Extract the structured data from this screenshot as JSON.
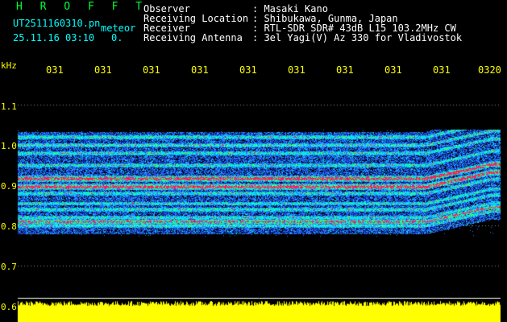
{
  "header": {
    "app_name": "H R O F F T",
    "file_name": "UT2511160310.pn",
    "event_type": "meteor",
    "datetime": "25.11.16 03:10",
    "count": "0.",
    "fields": [
      {
        "label": "Observer",
        "value": ": Masaki Kano"
      },
      {
        "label": "Receiving Location",
        "value": ": Shibukawa, Gunma, Japan"
      },
      {
        "label": "Receiver",
        "value": ": RTL-SDR SDR# 43dB L15 103.2MHz CW"
      },
      {
        "label": "Receiving Antenna",
        "value": ": 3el Yagi(V) Az 330 for Vladivostok"
      }
    ]
  },
  "chart_data": {
    "type": "heatmap",
    "ylabel": "kHz",
    "yticks": [
      "1.1",
      "1.0",
      "0.9",
      "0.8",
      "0.7",
      "0.6"
    ],
    "xticks": [
      "031",
      "031",
      "031",
      "031",
      "031",
      "031",
      "031",
      "031",
      "031",
      "0320"
    ],
    "ylim": [
      0.6,
      1.1
    ],
    "bands_khz": [
      0.8,
      0.82,
      0.84,
      0.855,
      0.88,
      0.9,
      0.92,
      0.95,
      0.98,
      1.0,
      1.02
    ],
    "strong_bands_khz": [
      0.81,
      0.895,
      0.915
    ],
    "signal_extent_khz": [
      0.785,
      1.03
    ],
    "colors": {
      "background": "#000000",
      "noise_low": "#0a2aa8",
      "noise_mid": "#2f74ff",
      "band_mid": "#00e0ff",
      "band_high": "#30ff70",
      "peak": "#ff1a60",
      "axis_text": "#ffff00",
      "grid": "#ffffff",
      "power_bar": "#ffff00"
    }
  }
}
